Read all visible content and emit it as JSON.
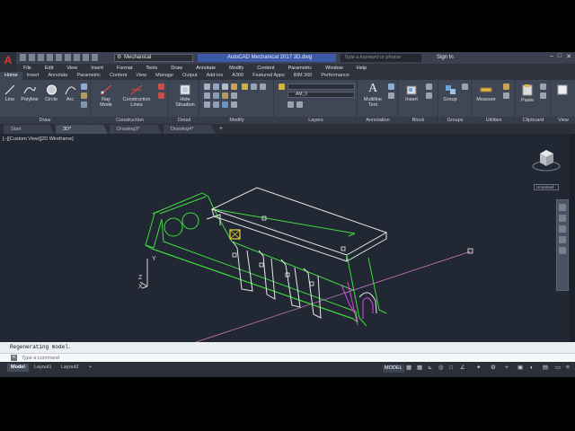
{
  "app": {
    "title": "AutoCAD Mechanical 2017   3D.dwg",
    "logo": "A",
    "workspace": "Mechanical",
    "search_placeholder": "Type a keyword or phrase",
    "sign_in": "Sign In"
  },
  "menubar": [
    "File",
    "Edit",
    "View",
    "Insert",
    "Format",
    "Tools",
    "Draw",
    "Annotate",
    "Modify",
    "Content",
    "Parametric",
    "Window",
    "Help"
  ],
  "ribbon_tabs": [
    "Home",
    "Insert",
    "Annotate",
    "Parametric",
    "Content",
    "View",
    "Manage",
    "Output",
    "Add-ins",
    "A360",
    "Featured Apps",
    "BIM 360",
    "Performance"
  ],
  "ribbon": {
    "draw": {
      "label": "Draw",
      "line": "Line",
      "polyline": "Polyline",
      "circle": "Circle",
      "arc": "Arc"
    },
    "construction": {
      "label": "Construction",
      "ray_mode": "Ray\nMode",
      "construction_lines": "Construction\nLines"
    },
    "detail": {
      "label": "Detail",
      "hide_situation": "Hide\nSituation"
    },
    "modify": {
      "label": "Modify"
    },
    "layers": {
      "label": "Layers",
      "current_layer": "AM_0"
    },
    "annotation": {
      "label": "Annotation",
      "multiline_text": "Multiline\nText"
    },
    "block": {
      "label": "Block",
      "insert": "Insert"
    },
    "groups": {
      "label": "Groups",
      "group": "Group"
    },
    "utilities": {
      "label": "Utilities",
      "measure": "Measure"
    },
    "clipboard": {
      "label": "Clipboard",
      "paste": "Paste"
    },
    "view": {
      "label": "View"
    }
  },
  "file_tabs": [
    "Start",
    "3D*",
    "Drawing3*",
    "Drawing4*"
  ],
  "viewport": {
    "label": "[−][Custom View][2D Wireframe]",
    "viewcube_label": "Unnamed",
    "axis_x": "X",
    "axis_y": "Y",
    "axis_z": "Z"
  },
  "command": {
    "history": "Regenerating model.",
    "placeholder": "Type a command"
  },
  "layout_tabs": [
    "Model",
    "Layout1",
    "Layout2"
  ],
  "status": {
    "model": "MODEL"
  },
  "colors": {
    "green": "#3fdc3f",
    "white": "#e8e8e8",
    "magenta": "#d84be0",
    "cyan": "#44c8d8",
    "grip_yellow": "#e6d23a"
  }
}
